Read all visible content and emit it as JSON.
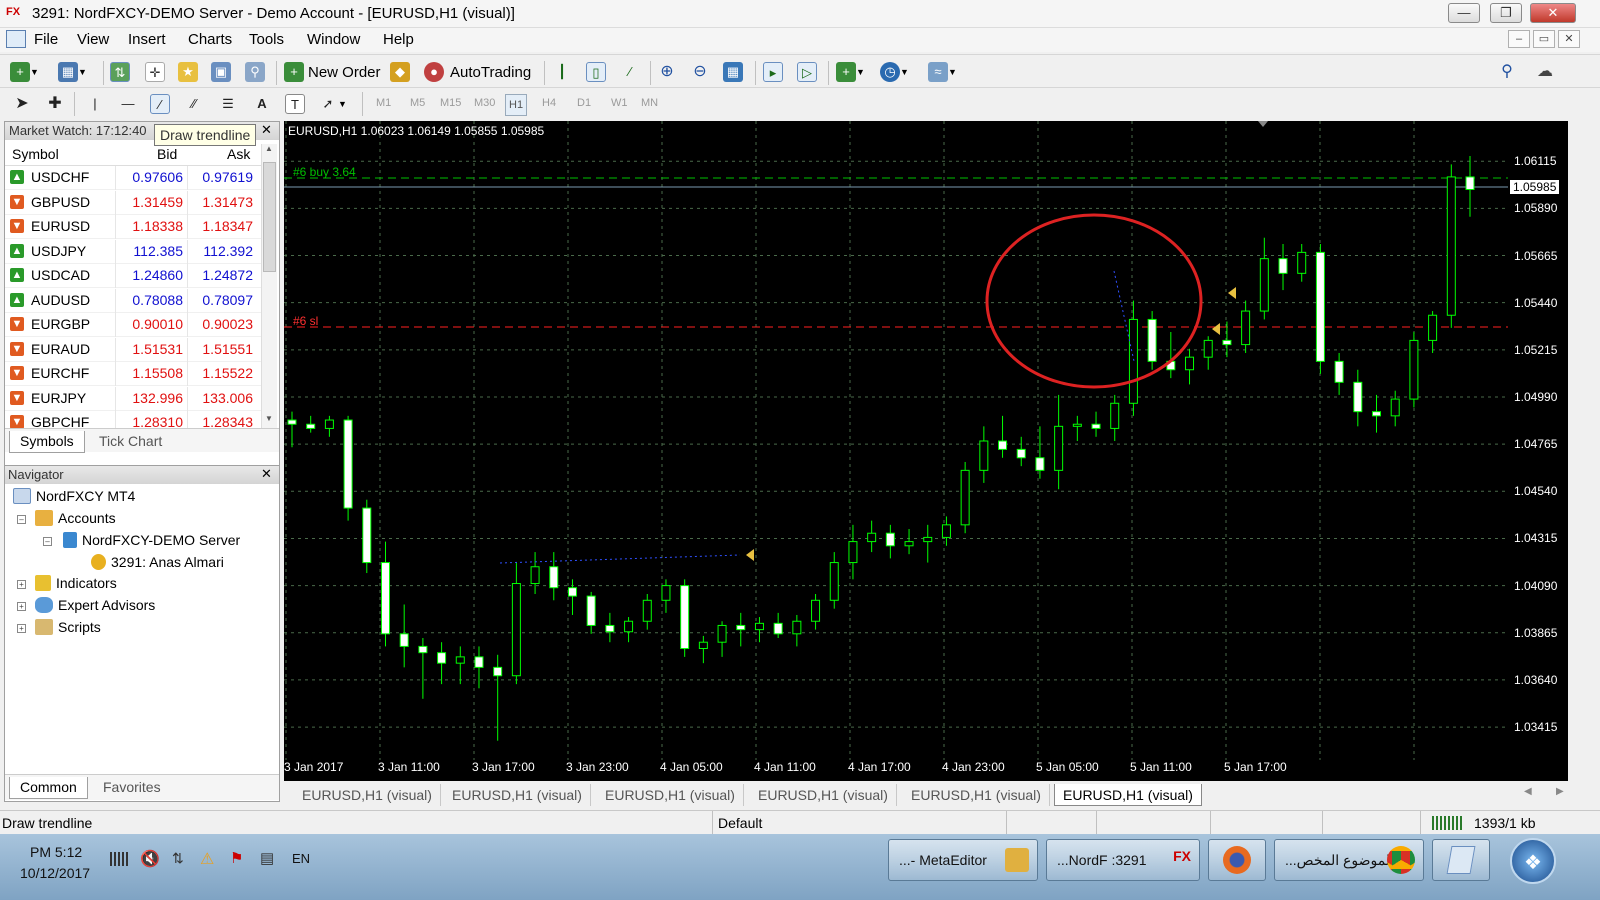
{
  "window": {
    "title": "3291: NordFXCY-DEMO Server - Demo Account - [EURUSD,H1 (visual)]",
    "app_logo": "FX"
  },
  "menu": [
    "File",
    "View",
    "Insert",
    "Charts",
    "Tools",
    "Window",
    "Help"
  ],
  "toolbar": {
    "new_order": "New Order",
    "autotrading": "AutoTrading"
  },
  "timeframes": [
    "M1",
    "M5",
    "M15",
    "M30",
    "H1",
    "H4",
    "D1",
    "W1",
    "MN"
  ],
  "active_timeframe": "H1",
  "tooltip": "Draw trendline",
  "market_watch": {
    "title": "Market Watch: 17:12:40",
    "columns": {
      "symbol": "Symbol",
      "bid": "Bid",
      "ask": "Ask"
    },
    "rows": [
      {
        "symbol": "USDCHF",
        "bid": "0.97606",
        "ask": "0.97619",
        "dir": "up"
      },
      {
        "symbol": "GBPUSD",
        "bid": "1.31459",
        "ask": "1.31473",
        "dir": "down"
      },
      {
        "symbol": "EURUSD",
        "bid": "1.18338",
        "ask": "1.18347",
        "dir": "down"
      },
      {
        "symbol": "USDJPY",
        "bid": "112.385",
        "ask": "112.392",
        "dir": "up"
      },
      {
        "symbol": "USDCAD",
        "bid": "1.24860",
        "ask": "1.24872",
        "dir": "up"
      },
      {
        "symbol": "AUDUSD",
        "bid": "0.78088",
        "ask": "0.78097",
        "dir": "up"
      },
      {
        "symbol": "EURGBP",
        "bid": "0.90010",
        "ask": "0.90023",
        "dir": "down"
      },
      {
        "symbol": "EURAUD",
        "bid": "1.51531",
        "ask": "1.51551",
        "dir": "down"
      },
      {
        "symbol": "EURCHF",
        "bid": "1.15508",
        "ask": "1.15522",
        "dir": "down"
      },
      {
        "symbol": "EURJPY",
        "bid": "132.996",
        "ask": "133.006",
        "dir": "down"
      },
      {
        "symbol": "GBPCHF",
        "bid": "1.28310",
        "ask": "1.28343",
        "dir": "down"
      }
    ],
    "tabs": [
      "Symbols",
      "Tick Chart"
    ]
  },
  "navigator": {
    "title": "Navigator",
    "root": "NordFXCY MT4",
    "accounts": "Accounts",
    "server": "NordFXCY-DEMO Server",
    "account": "3291: Anas Almari",
    "indicators": "Indicators",
    "experts": "Expert Advisors",
    "scripts": "Scripts",
    "tabs": [
      "Common",
      "Favorites"
    ]
  },
  "chart": {
    "header": "EURUSD,H1  1.06023 1.06149 1.05855 1.05985",
    "buy_label": "#6 buy 3.64",
    "sl_label": "#6 sl",
    "current_price": "1.05985",
    "price_ticks": [
      "1.06115",
      "1.05890",
      "1.05665",
      "1.05440",
      "1.05215",
      "1.04990",
      "1.04765",
      "1.04540",
      "1.04315",
      "1.04090",
      "1.03865",
      "1.03640",
      "1.03415"
    ],
    "time_ticks": [
      "3 Jan 2017",
      "3 Jan 11:00",
      "3 Jan 17:00",
      "3 Jan 23:00",
      "4 Jan 05:00",
      "4 Jan 11:00",
      "4 Jan 17:00",
      "4 Jan 23:00",
      "5 Jan 05:00",
      "5 Jan 11:00",
      "5 Jan 17:00"
    ],
    "candle_colors": {
      "bull": "#ffffff",
      "bear": "#ffffff",
      "wick": "#00ff00",
      "outline": "#00ff00"
    },
    "circle_color": "#dd2222",
    "buy_line_color": "#00c000",
    "sl_line_color": "#ff2020"
  },
  "chart_tabs": [
    "EURUSD,H1 (visual)",
    "EURUSD,H1 (visual)",
    "EURUSD,H1 (visual)",
    "EURUSD,H1 (visual)",
    "EURUSD,H1 (visual)",
    "EURUSD,H1 (visual)"
  ],
  "status": {
    "left": "Draw trendline",
    "profile": "Default",
    "traffic": "1393/1 kb"
  },
  "taskbar": {
    "time": "PM 5:12",
    "date": "10/12/2017",
    "lang": "EN",
    "tasks": [
      "...- MetaEditor",
      "...NordF :3291",
      "...الموضوع المخص"
    ]
  }
}
